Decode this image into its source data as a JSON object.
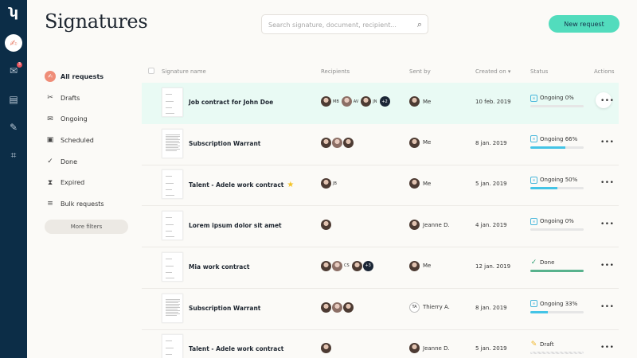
{
  "rail": {
    "logo": "ʮ",
    "items": [
      {
        "name": "signature-icon",
        "glyph": "✍"
      },
      {
        "name": "inbox-icon",
        "glyph": "✉",
        "badge": "3"
      },
      {
        "name": "document-icon",
        "glyph": "▤"
      },
      {
        "name": "edit-document-icon",
        "glyph": "✎"
      },
      {
        "name": "analytics-icon",
        "glyph": "⌗"
      }
    ]
  },
  "header": {
    "title": "Signatures",
    "search_placeholder": "Search signature, document, recipient...",
    "new_request_label": "New request"
  },
  "filters": [
    {
      "label": "All requests",
      "icon": "signature-icon",
      "glyph": "✍",
      "active": true
    },
    {
      "label": "Drafts",
      "icon": "draft-icon",
      "glyph": "✂"
    },
    {
      "label": "Ongoing",
      "icon": "ongoing-icon",
      "glyph": "✉"
    },
    {
      "label": "Scheduled",
      "icon": "calendar-icon",
      "glyph": "▣"
    },
    {
      "label": "Done",
      "icon": "check-icon",
      "glyph": "✓"
    },
    {
      "label": "Expired",
      "icon": "hourglass-icon",
      "glyph": "⧗"
    },
    {
      "label": "Bulk requests",
      "icon": "stack-icon",
      "glyph": "≡"
    }
  ],
  "more_filters_label": "More filters",
  "columns": {
    "name": "Signature name",
    "recipients": "Recipients",
    "sent_by": "Sent by",
    "created_on": "Created on ▾",
    "status": "Status",
    "actions": "Actions"
  },
  "rows": [
    {
      "name": "Job contract for John Doe",
      "star": false,
      "thumb": "sparse",
      "recipients": [
        {
          "t": "face"
        },
        {
          "t": "ini",
          "v": "MB"
        },
        {
          "t": "face"
        },
        {
          "t": "ini",
          "v": "AV"
        },
        {
          "t": "face"
        },
        {
          "t": "ini",
          "v": "JN"
        },
        {
          "t": "count",
          "v": "+2"
        }
      ],
      "sender": {
        "type": "face",
        "name": "Me"
      },
      "date": "10 feb. 2019",
      "status": {
        "label": "Ongoing 0%",
        "kind": "ongoing",
        "progress": 0
      },
      "highlight": true
    },
    {
      "name": "Subscription Warrant",
      "star": false,
      "thumb": "dense",
      "recipients": [
        {
          "t": "face"
        },
        {
          "t": "face"
        },
        {
          "t": "face"
        }
      ],
      "sender": {
        "type": "face",
        "name": "Me"
      },
      "date": "8 jan. 2019",
      "status": {
        "label": "Ongoing 66%",
        "kind": "ongoing",
        "progress": 66
      }
    },
    {
      "name": "Talent - Adele work contract",
      "star": true,
      "thumb": "sparse",
      "recipients": [
        {
          "t": "face"
        },
        {
          "t": "ini",
          "v": "JB"
        }
      ],
      "sender": {
        "type": "face",
        "name": "Me"
      },
      "date": "5 jan. 2019",
      "status": {
        "label": "Ongoing 50%",
        "kind": "ongoing",
        "progress": 50
      }
    },
    {
      "name": "Lorem ipsum dolor sit amet",
      "star": false,
      "thumb": "sparse",
      "recipients": [
        {
          "t": "face"
        }
      ],
      "sender": {
        "type": "face",
        "name": "Jeanne D."
      },
      "date": "4 jan. 2019",
      "status": {
        "label": "Ongoing 0%",
        "kind": "ongoing",
        "progress": 0
      }
    },
    {
      "name": "Mia work contract",
      "star": false,
      "thumb": "sparse",
      "recipients": [
        {
          "t": "face"
        },
        {
          "t": "face"
        },
        {
          "t": "ini",
          "v": "CS"
        },
        {
          "t": "face"
        },
        {
          "t": "count",
          "v": "+3"
        }
      ],
      "sender": {
        "type": "face",
        "name": "Me"
      },
      "date": "12 jan. 2019",
      "status": {
        "label": "Done",
        "kind": "done",
        "progress": 100
      }
    },
    {
      "name": "Subscription Warrant",
      "star": false,
      "thumb": "dense",
      "recipients": [
        {
          "t": "face"
        },
        {
          "t": "face"
        },
        {
          "t": "face"
        }
      ],
      "sender": {
        "type": "initials",
        "initials": "TA",
        "name": "Thierry A."
      },
      "date": "8 jan. 2019",
      "status": {
        "label": "Ongoing 33%",
        "kind": "ongoing",
        "progress": 33
      }
    },
    {
      "name": "Talent - Adele work contract",
      "star": false,
      "thumb": "sparse",
      "recipients": [
        {
          "t": "face"
        }
      ],
      "sender": {
        "type": "face",
        "name": "Jeanne D."
      },
      "date": "5 jan. 2019",
      "status": {
        "label": "Draft",
        "kind": "draft",
        "progress": 0
      }
    }
  ],
  "row_action_glyph": "•••",
  "icons": {
    "search": "⌕",
    "star": "★",
    "done": "✓",
    "draft": "✎",
    "ongoing": "✉"
  },
  "colors": {
    "accent": "#52dcbd",
    "rail": "#0c2d47",
    "progress": "#44c4e6",
    "done": "#58b28d",
    "highlight": "#e9faf4",
    "star": "#f4c326"
  }
}
